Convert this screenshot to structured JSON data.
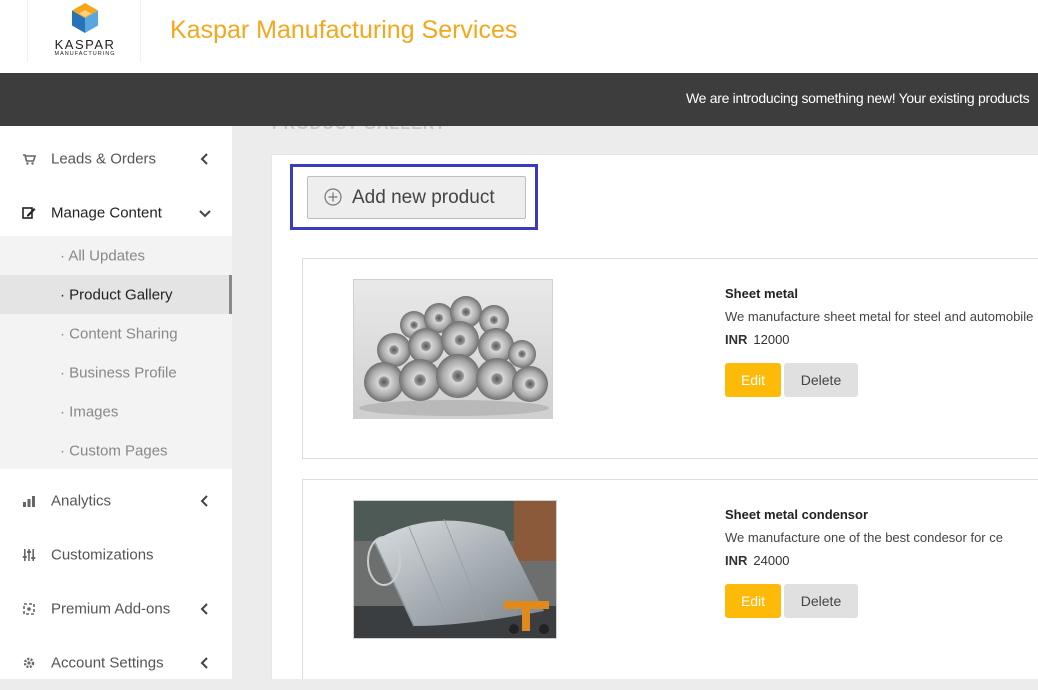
{
  "header": {
    "logo_name": "KASPAR",
    "logo_sub": "MANUFACTURING",
    "company_name": "Kaspar Manufacturing Services"
  },
  "banner": {
    "text": "We are introducing something new! Your existing products"
  },
  "sidebar": {
    "items": [
      {
        "label": "Leads & Orders",
        "icon": "cart-icon"
      },
      {
        "label": "Manage Content",
        "icon": "edit-icon"
      },
      {
        "label": "Analytics",
        "icon": "bar-chart-icon"
      },
      {
        "label": "Customizations",
        "icon": "sliders-icon"
      },
      {
        "label": "Premium Add-ons",
        "icon": "puzzle-icon"
      },
      {
        "label": "Account Settings",
        "icon": "gear-icon"
      }
    ],
    "subitems": [
      {
        "label": "· All Updates"
      },
      {
        "label": "· Product Gallery"
      },
      {
        "label": "· Content Sharing"
      },
      {
        "label": "· Business Profile"
      },
      {
        "label": "· Images"
      },
      {
        "label": "· Custom Pages"
      }
    ]
  },
  "main": {
    "section_title": "PRODUCT GALLERY",
    "add_button_label": "Add new product",
    "products": [
      {
        "title": "Sheet metal",
        "description": "We manufacture sheet metal for steel and automobile",
        "currency": "INR",
        "price": "12000",
        "edit_label": "Edit",
        "delete_label": "Delete"
      },
      {
        "title": "Sheet metal condensor",
        "description": "We manufacture one of the best condesor for ce",
        "currency": "INR",
        "price": "24000",
        "edit_label": "Edit",
        "delete_label": "Delete"
      }
    ]
  },
  "colors": {
    "brand": "#f5a71b",
    "edit_button": "#fdba09",
    "banner_bg": "#3d3d3d",
    "highlight": "#3b3bbd"
  }
}
